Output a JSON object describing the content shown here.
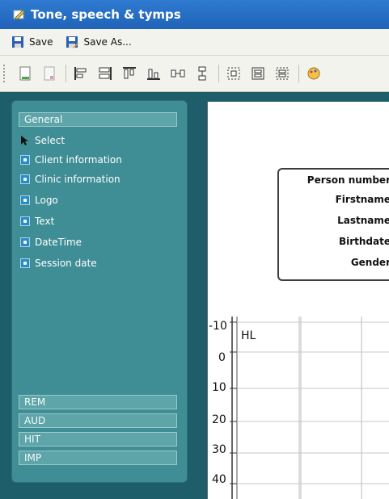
{
  "window": {
    "title": "Tone, speech & tymps"
  },
  "menubar": {
    "save_label": "Save",
    "save_as_label": "Save As..."
  },
  "toolbar": {
    "icons": [
      "new-page-icon",
      "blank-page-icon",
      "align-left-icon",
      "align-center-icon",
      "align-top-icon",
      "align-bottom-icon",
      "space-horizontal-icon",
      "space-vertical-icon",
      "center-icon",
      "group-icon",
      "ungroup-icon",
      "palette-icon"
    ]
  },
  "left_panel": {
    "general_label": "General",
    "items": [
      {
        "label": "Select",
        "icon": "arrow-pointer-icon"
      },
      {
        "label": "Client information",
        "icon": "element-icon"
      },
      {
        "label": "Clinic information",
        "icon": "element-icon"
      },
      {
        "label": "Logo",
        "icon": "element-icon"
      },
      {
        "label": "Text",
        "icon": "element-icon"
      },
      {
        "label": "DateTime",
        "icon": "element-icon"
      },
      {
        "label": "Session date",
        "icon": "element-icon"
      }
    ],
    "bottom_groups": [
      "REM",
      "AUD",
      "HIT",
      "IMP"
    ]
  },
  "person_box": {
    "fields": [
      "Person number",
      "Firstname",
      "Lastname",
      "Birthdate",
      "Gender"
    ]
  },
  "audiogram": {
    "unit_label": "HL",
    "y_ticks": [
      "-10",
      "0",
      "10",
      "20",
      "30",
      "40"
    ]
  },
  "colors": {
    "title_bar": "#2f7bd1",
    "panel": "#3f8e95",
    "workspace": "#1e5e6b"
  }
}
